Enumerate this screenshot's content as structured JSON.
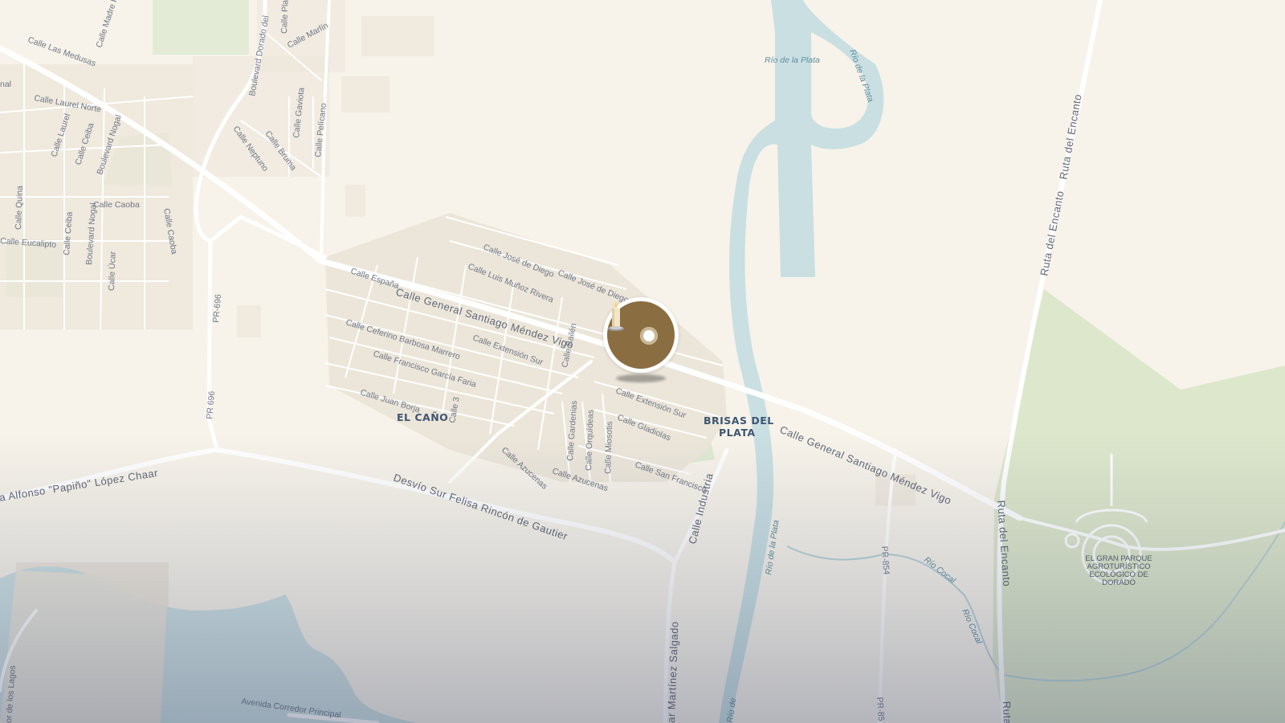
{
  "map": {
    "colors": {
      "land": "#f7f3ea",
      "water": "#c9dfe2",
      "park": "#dfe8cf",
      "road_major": "#ffffff",
      "label_text": "#6f7787",
      "place_text": "#3e5572",
      "marker_fill": "#8b6d42"
    },
    "places": {
      "el_cano": "EL CAÑO",
      "brisas_line1": "BRISAS DEL",
      "brisas_line2": "PLATA",
      "park_line1": "EL GRAN PARQUE",
      "park_line2": "AGROTURÍSTICO",
      "park_line3": "ECOLÓGICO DE",
      "park_line4": "DORADO"
    },
    "roads": {
      "santiago_mendez_1": "Calle General Santiago Méndez Vigo",
      "santiago_mendez_2": "Calle General Santiago Méndez Vigo",
      "desvio_sur": "Desvío Sur Felisa Rincón de Gautier",
      "alfonso": "a Alfonso \"Papiño\" López Chaar",
      "industria": "Calle Industria",
      "martinez_salgado": "ar Martínez Salgado",
      "ruta_encanto_1": "Ruta del Encanto",
      "ruta_encanto_2": "Ruta del Encanto",
      "ruta_encanto_3": "Ruta del Encanto",
      "ruta_encanto_4": "Ruta",
      "pr696_1": "PR-696",
      "pr696_2": "PR 696",
      "pr854_1": "PR-854",
      "pr854_2": "PR-85",
      "corredor": "Avenida Corredor Principal",
      "lagos": "or de los Lagos",
      "dorado": "Boulevard Dorado del",
      "madre": "Calle Madre P",
      "medusas": "Calle Las Medusas",
      "laurel_norte": "Calle Laurel Norte",
      "laurel": "Calle Laurel",
      "ceiba_1": "Calle Ceiba",
      "ceiba_2": "Calle Ceiba",
      "nogal_1": "Boulevard Nogal",
      "nogal_2": "Boulevard Nogal",
      "caoba_1": "Calle Caoba",
      "caoba_2": "Calle Caoba",
      "quina": "Calle Quina",
      "eucalipto": "Calle Eucalipto",
      "ucar": "Calle Úcar",
      "neptuno": "Calle Neptuno",
      "bruma": "Calle Bruma",
      "gaviota": "Calle Gaviota",
      "pelicano": "Calle Pelícano",
      "marlin": "Calle Marlín",
      "playa": "Calle Play",
      "espana": "Calle España",
      "jose_diego_1": "Calle José de Diego",
      "jose_diego_2": "Calle José de Diego",
      "munoz": "Calle Luis Muñoz Rivera",
      "barbosa": "Calle Ceferino Barbosa Marrero",
      "extension_1": "Calle Extensión Sur",
      "extension_2": "Calle Extensión Sur",
      "garcia_faria": "Calle Francisco García Faria",
      "bailen": "Calle Bailén",
      "borja": "Calle Juan Borja",
      "c3": "Calle 3",
      "gladiolas": "Calle Gladiolas",
      "azucenas_1": "Calle Azucenas",
      "azucenas_2": "Calle Azucenas",
      "gardenias": "Calle Gardenias",
      "orquideas": "Calle Orquídeas",
      "miosotis": "Calle Miosotis",
      "san_francisco": "Calle San Francisco",
      "nal": "nal"
    },
    "water": {
      "plata_1": "Río de la Plata",
      "plata_2": "Río de la Plata",
      "plata_3": "Río de la Plata",
      "plata_4": "Río de",
      "cocal_1": "Río Cocal",
      "cocal_2": "Río Cocal"
    },
    "marker": {
      "icon": "candle-icon"
    }
  }
}
